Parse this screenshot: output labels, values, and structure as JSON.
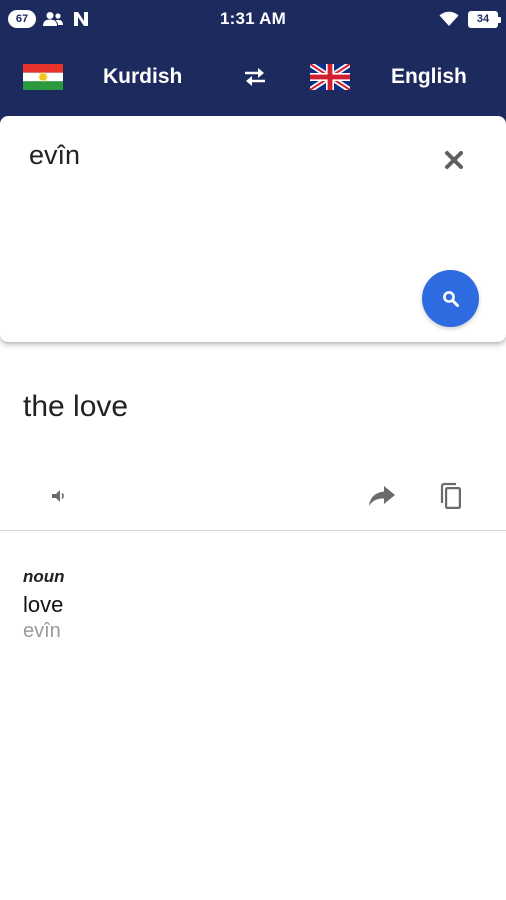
{
  "status_bar": {
    "notification_count": "67",
    "time": "1:31 AM",
    "battery": "34",
    "icons": [
      "contacts-icon",
      "n-app-icon",
      "wifi-icon",
      "battery-icon"
    ]
  },
  "language_bar": {
    "source_language": "Kurdish",
    "target_language": "English",
    "source_flag": "kurdistan-flag-icon",
    "target_flag": "uk-flag-icon",
    "swap_icon": "swap-arrows-icon"
  },
  "input": {
    "text": "evîn",
    "clear_icon": "close-icon",
    "search_icon": "search-icon"
  },
  "result": {
    "translation": "the love",
    "actions": [
      "speaker-icon",
      "share-icon",
      "copy-icon"
    ]
  },
  "dictionary": {
    "part_of_speech": "noun",
    "word": "love",
    "reverse_translation": "evîn"
  },
  "colors": {
    "header_bg": "#1c2a5e",
    "accent": "#2f6be0",
    "text_primary": "#222222",
    "text_secondary": "#9a9a9a"
  }
}
